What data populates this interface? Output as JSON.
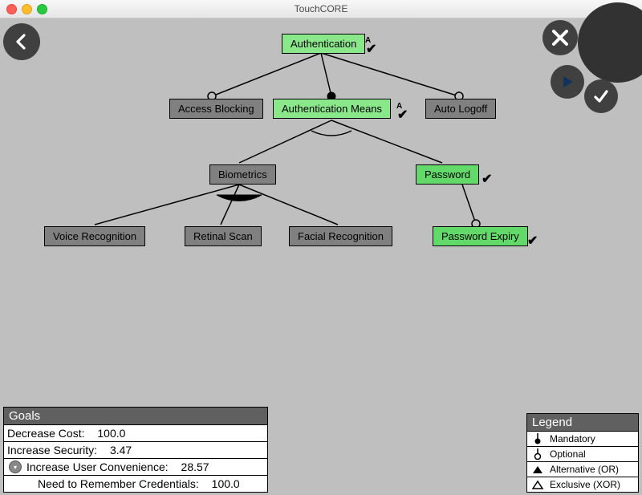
{
  "window": {
    "title": "TouchCORE"
  },
  "nodes": {
    "root": {
      "label": "Authentication",
      "selected": true
    },
    "access_blocking": {
      "label": "Access Blocking",
      "selected": false
    },
    "auth_means": {
      "label": "Authentication Means",
      "selected": true
    },
    "auto_logoff": {
      "label": "Auto Logoff",
      "selected": false
    },
    "biometrics": {
      "label": "Biometrics",
      "selected": false
    },
    "password": {
      "label": "Password",
      "selected": true
    },
    "voice": {
      "label": "Voice Recognition",
      "selected": false
    },
    "retinal": {
      "label": "Retinal Scan",
      "selected": false
    },
    "facial": {
      "label": "Facial Recognition",
      "selected": false
    },
    "pw_expiry": {
      "label": "Password Expiry",
      "selected": true
    }
  },
  "goals": {
    "header": "Goals",
    "items": [
      {
        "label": "Decrease Cost:",
        "value": "100.0"
      },
      {
        "label": "Increase Security:",
        "value": "3.47"
      },
      {
        "label": "Increase User Convenience:",
        "value": "28.57",
        "expandable": true
      },
      {
        "label": "Need to Remember Credentials:",
        "value": "100.0",
        "indent": true
      }
    ]
  },
  "legend": {
    "header": "Legend",
    "items": [
      {
        "label": "Mandatory",
        "icon": "mandatory"
      },
      {
        "label": "Optional",
        "icon": "optional"
      },
      {
        "label": "Alternative (OR)",
        "icon": "or"
      },
      {
        "label": "Exclusive (XOR)",
        "icon": "xor"
      }
    ]
  },
  "colors": {
    "selected": "#62d969",
    "selected_light": "#8ae78a",
    "unselected": "#808080",
    "panel_header": "#606060",
    "dark_button": "#404040"
  }
}
